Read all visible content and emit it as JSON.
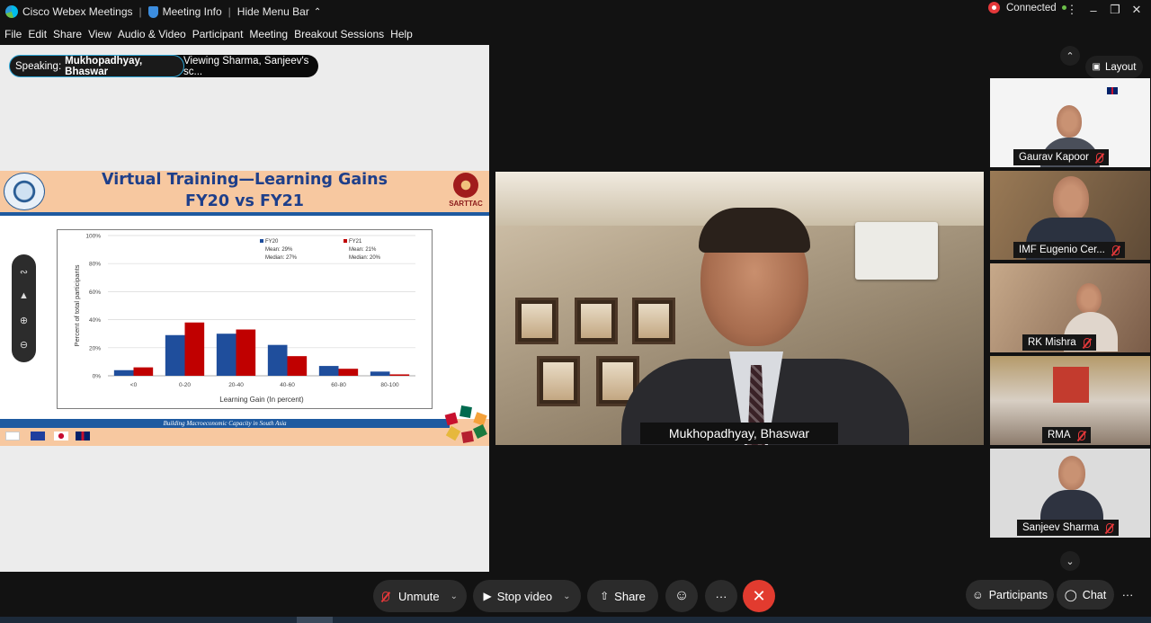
{
  "titlebar": {
    "app_name": "Cisco Webex Meetings",
    "meeting_info": "Meeting Info",
    "hide_menu": "Hide Menu Bar",
    "status": "Connected"
  },
  "menu": [
    "File",
    "Edit",
    "Share",
    "View",
    "Audio & Video",
    "Participant",
    "Meeting",
    "Breakout Sessions",
    "Help"
  ],
  "share": {
    "speaking_label": "Speaking:",
    "speaking_name": "Mukhopadhyay, Bhaswar",
    "viewing": "Viewing Sharma, Sanjeev's sc..."
  },
  "slide": {
    "title_line1": "Virtual Training—Learning Gains",
    "title_line2": "FY20 vs FY21",
    "logo_text": "SARTTAC",
    "footer_text": "Building Macroeconomic Capacity in South Asia"
  },
  "chart_data": {
    "type": "bar",
    "categories": [
      "<0",
      "0-20",
      "20-40",
      "40-60",
      "60-80",
      "80-100"
    ],
    "series": [
      {
        "name": "FY20",
        "values": [
          4,
          29,
          30,
          22,
          7,
          3
        ],
        "color": "#1f4e9c",
        "mean": "Mean: 29%",
        "median": "Median: 27%"
      },
      {
        "name": "FY21",
        "values": [
          6,
          38,
          33,
          14,
          5,
          1
        ],
        "color": "#c00000",
        "mean": "Mean: 21%",
        "median": "Median: 20%"
      }
    ],
    "yticks": [
      "0%",
      "20%",
      "40%",
      "60%",
      "80%",
      "100%"
    ],
    "ylim": [
      0,
      100
    ],
    "xlabel": "Learning Gain (In percent)",
    "ylabel": "Percent of total participants",
    "grid": true,
    "legend": "top-right"
  },
  "active_speaker": {
    "name": "Mukhopadhyay, Bhaswar"
  },
  "thumbnails": [
    {
      "name": "Gaurav Kapoor"
    },
    {
      "name": "IMF Eugenio Cer..."
    },
    {
      "name": "RK Mishra"
    },
    {
      "name": "RMA"
    },
    {
      "name": "Sanjeev Sharma"
    }
  ],
  "layout_label": "Layout",
  "controls": {
    "unmute": "Unmute",
    "stop_video": "Stop video",
    "share": "Share",
    "more": "···",
    "participants": "Participants",
    "chat": "Chat"
  },
  "colors": {
    "accent": "#2ca6d6",
    "leave": "#e23b2f",
    "fy20": "#1f4e9c",
    "fy21": "#c00000"
  }
}
